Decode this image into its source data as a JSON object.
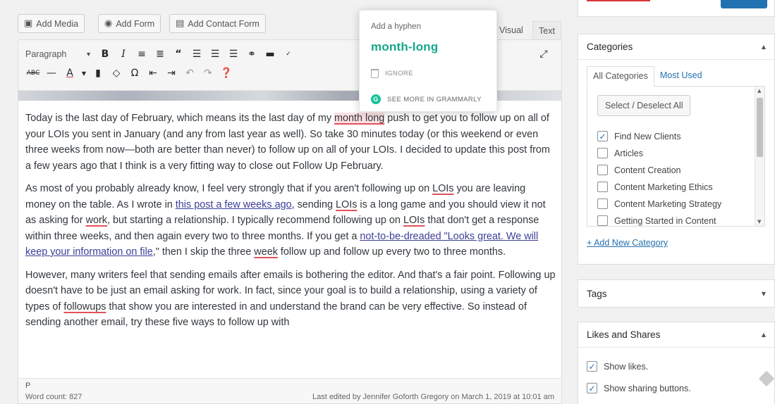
{
  "media_buttons": [
    {
      "icon": "media-icon",
      "label": "Add Media"
    },
    {
      "icon": "form-icon",
      "label": "Add Form"
    },
    {
      "icon": "contact-form-icon",
      "label": "Add Contact Form"
    }
  ],
  "editor_tabs": {
    "visual": "Visual",
    "text": "Text"
  },
  "toolbar": {
    "format_select": "Paragraph"
  },
  "content": {
    "p1_a": "Today is the last day of February, which means its the last day of my ",
    "p1_err": "month long",
    "p1_b": " push to get you to follow up on all of your LOIs you sent in January (and any from last year as well). So take 30 minutes today (or this weekend or even three weeks from now—both are better than never) to follow up on all of your LOIs. I decided to update this post from a few years ago that I think is a very fitting way to close out Follow Up February.",
    "p2_a": "As most of you probably already know, I feel very strongly that if you aren't following up on ",
    "p2_lois1": "LOIs",
    "p2_b": " you are leaving money on the table. As I wrote in ",
    "p2_link1": "this post a few weeks ago",
    "p2_c": ", sending ",
    "p2_lois2": "LOIs",
    "p2_d": " is a long game and you should view it not as asking for ",
    "p2_work": "work",
    "p2_e": ", but starting a relationship. I typically recommend following up on ",
    "p2_lois3": "LOIs",
    "p2_f": " that don't get a response within three weeks, and then again every two to three months. If you get a ",
    "p2_link2": "not-to-be-dreaded \"Looks great. We will keep your information on file",
    "p2_g": ",\" then I skip the three ",
    "p2_week": "week",
    "p2_h": " follow up and follow up every two to three months.",
    "p3_a": "However, many writers feel that sending emails after emails is bothering the editor. And that's a fair point. Following up doesn't have to be just an email asking for work. In fact, since your goal is to build a relationship, using a variety of types of ",
    "p3_followups": "followups",
    "p3_b": " that show you are interested in and understand the brand can be very effective. So instead of sending another email, try these five ways to follow up with"
  },
  "statusbar": {
    "path": "P",
    "word_count": "Word count: 827",
    "last_edited": "Last edited by Jennifer Goforth Gregory on March 1, 2019 at 10:01 am"
  },
  "grammarly": {
    "title": "Add a hyphen",
    "suggestion": "month-long",
    "ignore": "IGNORE",
    "more": "SEE MORE IN GRAMMARLY"
  },
  "categories": {
    "title": "Categories",
    "tab_all": "All Categories",
    "tab_used": "Most Used",
    "select_all": "Select / Deselect All",
    "items": [
      {
        "label": "Find New Clients",
        "checked": true
      },
      {
        "label": "Articles",
        "checked": false
      },
      {
        "label": "Content Creation",
        "checked": false
      },
      {
        "label": "Content Marketing Ethics",
        "checked": false
      },
      {
        "label": "Content Marketing Strategy",
        "checked": false
      },
      {
        "label": "Getting Started in Content",
        "checked": false
      }
    ],
    "add_new": "+ Add New Category"
  },
  "tags": {
    "title": "Tags"
  },
  "likes": {
    "title": "Likes and Shares",
    "show_likes": "Show likes.",
    "show_sharing": "Show sharing buttons."
  },
  "colors": {
    "accent": "#2271b1",
    "grammarly_green": "#15a78b",
    "error_red": "#e0525b"
  }
}
